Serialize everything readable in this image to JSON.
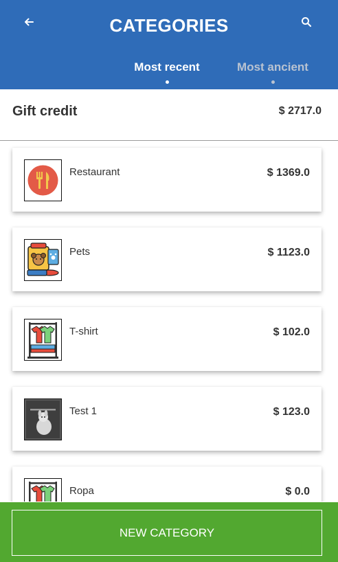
{
  "header": {
    "title": "CATEGORIES",
    "back_icon": "back-arrow-icon",
    "search_icon": "search-icon",
    "background": "#2f6cb8"
  },
  "tabs": [
    {
      "label": "Most recent",
      "active": true
    },
    {
      "label": "Most ancient",
      "active": false
    }
  ],
  "credit": {
    "label": "Gift credit",
    "amount": "$ 2717.0"
  },
  "categories": [
    {
      "name": "Restaurant",
      "amount": "$ 1369.0",
      "icon": "restaurant-icon"
    },
    {
      "name": "Pets",
      "amount": "$ 1123.0",
      "icon": "pets-icon"
    },
    {
      "name": "T-shirt",
      "amount": "$ 102.0",
      "icon": "clothes-rack-icon"
    },
    {
      "name": "Test 1",
      "amount": "$ 123.0",
      "icon": "photo-thumbnail"
    },
    {
      "name": "Ropa",
      "amount": "$ 0.0",
      "icon": "clothes-rack-icon"
    }
  ],
  "footer": {
    "button_label": "NEW CATEGORY",
    "background": "#52a830"
  }
}
